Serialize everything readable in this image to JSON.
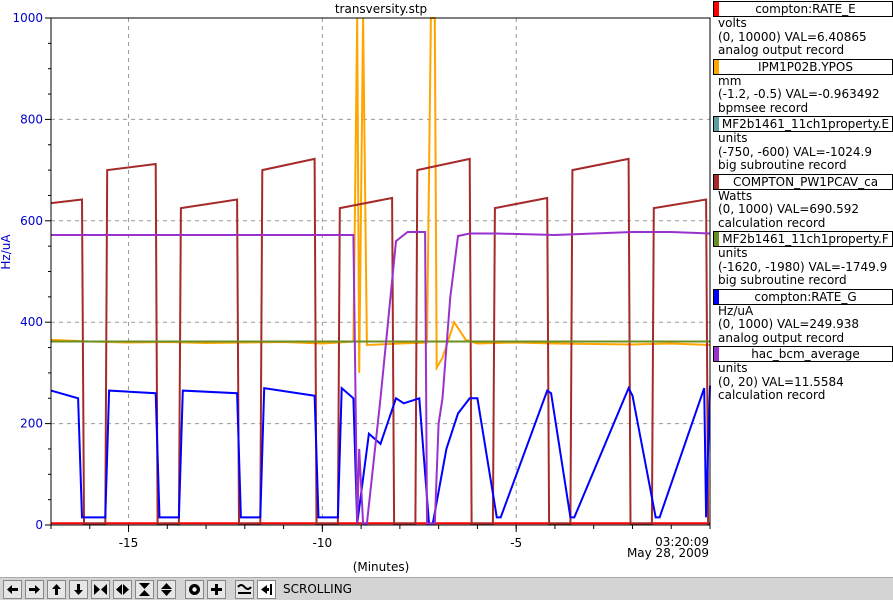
{
  "chart_data": {
    "type": "line",
    "title": "transversity.stp",
    "xlabel": "(Minutes)",
    "ylabel": "Hz/uA",
    "xlim": [
      -17,
      0
    ],
    "ylim": [
      0,
      1000
    ],
    "y_ticks": [
      0,
      200,
      400,
      600,
      800,
      1000
    ],
    "x_ticks": [
      -15,
      -10,
      -5
    ],
    "grid": true,
    "time_label": "03:20:09",
    "date_label": "May 28, 2009",
    "series": [
      {
        "name": "compton:RATE_E",
        "color": "#ff0000",
        "units": "volts",
        "range": "(0, 10000)",
        "value": "VAL=6.40865",
        "record": "analog output record",
        "x": [
          -17,
          0
        ],
        "y": [
          3.5,
          3.5
        ]
      },
      {
        "name": "IPM1P02B.YPOS",
        "color": "#ffa500",
        "units": "mm",
        "range": "(-1.2, -0.5)",
        "value": "VAL=-0.963492",
        "record": "bpmsee record",
        "x": [
          -17,
          -16,
          -15,
          -14,
          -13,
          -12,
          -11,
          -10,
          -9.2,
          -9.1,
          -9.05,
          -8.95,
          -8.85,
          -8,
          -7.3,
          -7.2,
          -7.1,
          -7.05,
          -6.9,
          -6.6,
          -6.3,
          -6,
          -5,
          -4,
          -3,
          -2,
          -1,
          0
        ],
        "y": [
          365,
          362,
          360,
          361,
          359,
          360,
          361,
          358,
          362,
          1000,
          300,
          1000,
          355,
          358,
          360,
          1000,
          1000,
          310,
          330,
          400,
          365,
          358,
          360,
          358,
          357,
          356,
          358,
          355
        ]
      },
      {
        "name": "MF2b1461_11ch1property.E",
        "color": "#5f9ea0",
        "units": "units",
        "range": "(-750, -600)",
        "value": "VAL=-1024.9",
        "record": "big subroutine record",
        "x": [],
        "y": []
      },
      {
        "name": "COMPTON_PW1PCAV_ca",
        "color": "#a52a2a",
        "units": "Watts",
        "range": "(0, 1000)",
        "value": "VAL=690.592",
        "record": "calculation record",
        "x": [
          -17,
          -16.2,
          -16.15,
          -15.6,
          -15.55,
          -14.3,
          -14.25,
          -13.7,
          -13.65,
          -12.2,
          -12.15,
          -11.6,
          -11.55,
          -10.2,
          -10.15,
          -9.6,
          -9.55,
          -8.2,
          -8.15,
          -7.6,
          -7.55,
          -6.2,
          -6.15,
          -5.6,
          -5.55,
          -4.2,
          -4.15,
          -3.6,
          -3.55,
          -2.1,
          -2.05,
          -1.5,
          -1.45,
          -0.1,
          -0.05,
          0
        ],
        "y": [
          635,
          642,
          3,
          3,
          700,
          712,
          3,
          3,
          625,
          642,
          3,
          3,
          700,
          722,
          3,
          3,
          625,
          645,
          3,
          3,
          700,
          722,
          3,
          3,
          625,
          645,
          3,
          3,
          700,
          722,
          3,
          3,
          625,
          642,
          3,
          3
        ]
      },
      {
        "name": "MF2b1461_11ch1property.F",
        "color": "#6b8e23",
        "units": "units",
        "range": "(-1620, -1980)",
        "value": "VAL=-1749.9",
        "record": "big subroutine record",
        "x": [
          -17,
          0
        ],
        "y": [
          362,
          362
        ]
      },
      {
        "name": "compton:RATE_G",
        "color": "#0000ff",
        "units": "Hz/uA",
        "range": "(0, 1000)",
        "value": "VAL=249.938",
        "record": "analog output record",
        "x": [
          -17,
          -16.3,
          -16.2,
          -15.6,
          -15.5,
          -14.3,
          -14.2,
          -13.7,
          -13.6,
          -12.2,
          -12.1,
          -11.6,
          -11.5,
          -10.2,
          -10.1,
          -9.6,
          -9.5,
          -9.2,
          -9.1,
          -8.8,
          -8.5,
          -8.1,
          -7.9,
          -7.5,
          -7.25,
          -7.15,
          -6.8,
          -6.5,
          -6.2,
          -6.0,
          -5.5,
          -5.4,
          -4.2,
          -4.1,
          -3.6,
          -3.5,
          -2.1,
          -2.0,
          -1.4,
          -1.3,
          -0.15,
          -0.1,
          0
        ],
        "y": [
          265,
          250,
          15,
          15,
          265,
          260,
          15,
          15,
          265,
          260,
          15,
          15,
          270,
          255,
          15,
          15,
          270,
          250,
          3,
          180,
          160,
          250,
          240,
          250,
          3,
          3,
          150,
          220,
          250,
          250,
          15,
          15,
          265,
          260,
          15,
          15,
          270,
          255,
          15,
          15,
          270,
          15,
          275
        ]
      },
      {
        "name": "hac_bcm_average",
        "color": "#9932cc",
        "units": "units",
        "range": "(0, 20)",
        "value": "VAL=11.5584",
        "record": "calculation record",
        "x": [
          -17,
          -10,
          -9.2,
          -9.1,
          -9.05,
          -8.95,
          -8.85,
          -8.5,
          -8.1,
          -7.8,
          -7.35,
          -7.3,
          -7.1,
          -7.0,
          -6.9,
          -6.7,
          -6.5,
          -6.2,
          -5.5,
          -4,
          -3,
          -2,
          -1,
          0
        ],
        "y": [
          572,
          572,
          572,
          3,
          150,
          3,
          3,
          250,
          560,
          578,
          578,
          3,
          3,
          200,
          250,
          450,
          570,
          575,
          575,
          572,
          575,
          578,
          578,
          575
        ]
      }
    ]
  },
  "toolbar": {
    "status": "SCROLLING",
    "buttons": [
      "arrow-left-icon",
      "arrow-right-icon",
      "arrow-up-icon",
      "arrow-down-icon",
      "zoom-in-x-icon",
      "zoom-out-x-icon",
      "zoom-in-y-icon",
      "zoom-out-y-icon",
      "auto-scale-icon",
      "reset-icon",
      "toggle-icon",
      "scroll-icon"
    ]
  }
}
